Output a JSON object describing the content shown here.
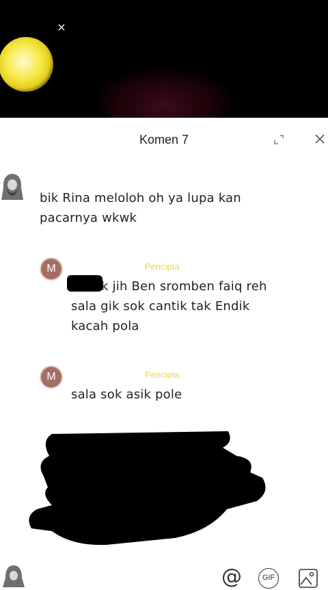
{
  "video": {
    "close_glyph": "×"
  },
  "sheet": {
    "title": "Komen 7",
    "icons": {
      "expand": "expand-icon",
      "close": "close-icon"
    }
  },
  "comments": [
    {
      "text_line1": "bik Rina meloloh oh ya lupa kan",
      "text_line2": "pacarnya wkwk"
    },
    {
      "avatar_letter": "M",
      "badge": "Pencipta",
      "text_line1": "k jih Ben sromben faiq reh",
      "text_line2": "sala gik sok cantik tak Endik",
      "text_line3": "kacah pola"
    },
    {
      "avatar_letter": "M",
      "badge": "Pencipta",
      "text_line1": "sala sok asik pole"
    }
  ],
  "bottom_bar": {
    "icons": [
      "mention-icon",
      "gif-icon",
      "image-icon"
    ],
    "gif_label": "GIF",
    "mention_glyph": "@"
  },
  "colors": {
    "creator_badge": "#f3d34a",
    "avatar_m": "#a36e66"
  }
}
